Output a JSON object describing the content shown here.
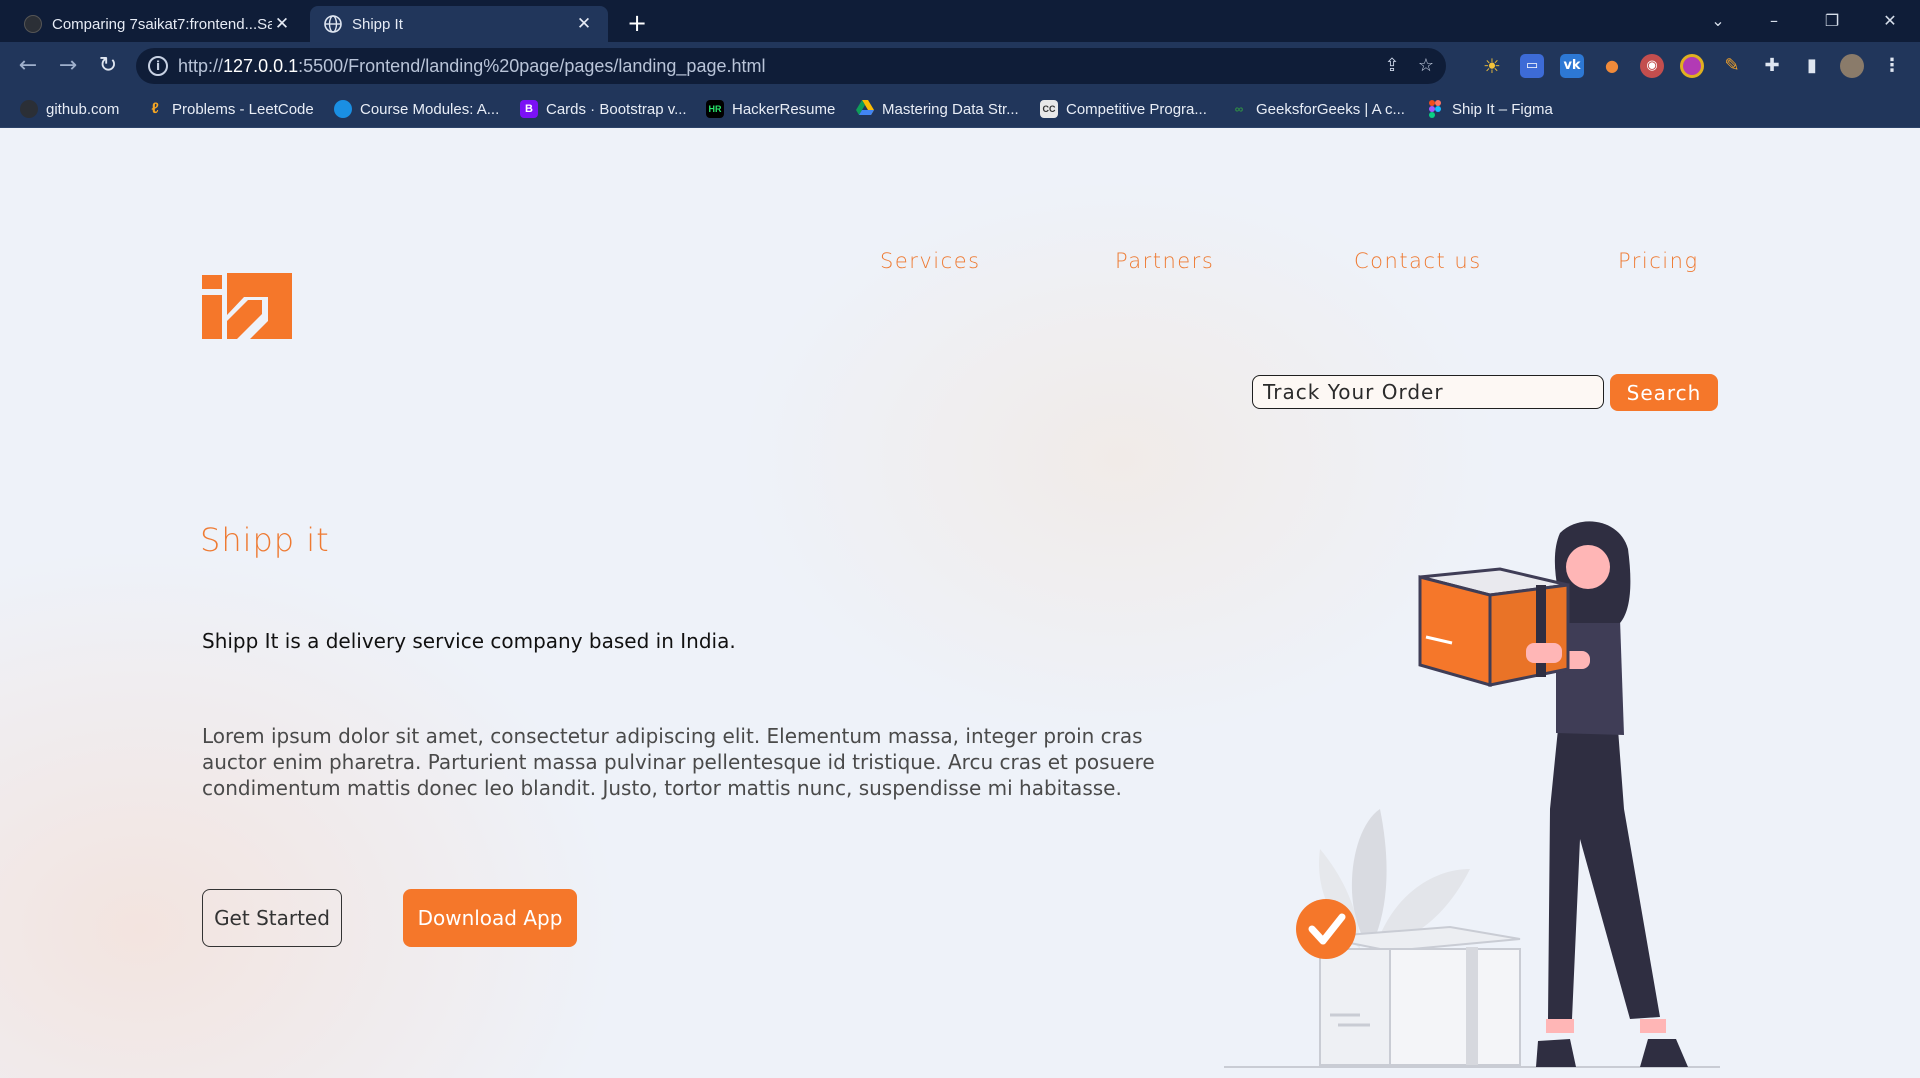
{
  "browser": {
    "tabs": [
      {
        "title": "Comparing 7saikat7:frontend...Sa",
        "active": false,
        "icon": "github-icon"
      },
      {
        "title": "Shipp It",
        "active": true,
        "icon": "globe-icon"
      }
    ],
    "address": {
      "scheme": "http://",
      "host": "127.0.0.1",
      "path": ":5500/Frontend/landing%20page/pages/landing_page.html"
    },
    "bookmarks": [
      {
        "label": "github.com",
        "icon": "github-icon"
      },
      {
        "label": "Problems - LeetCode",
        "icon": "leetcode-icon"
      },
      {
        "label": "Course Modules: A...",
        "icon": "cloud-icon"
      },
      {
        "label": "Cards · Bootstrap v...",
        "icon": "bootstrap-icon"
      },
      {
        "label": "HackerResume",
        "icon": "hackerresume-icon"
      },
      {
        "label": "Mastering Data Str...",
        "icon": "drive-icon"
      },
      {
        "label": "Competitive Progra...",
        "icon": "cc-icon"
      },
      {
        "label": "GeeksforGeeks | A c...",
        "icon": "gfg-icon"
      },
      {
        "label": "Ship It – Figma",
        "icon": "figma-icon"
      }
    ]
  },
  "nav": {
    "services": "Services",
    "partners": "Partners",
    "contact": "Contact us",
    "pricing": "Pricing"
  },
  "search": {
    "placeholder": "Track Your Order",
    "button": "Search"
  },
  "hero": {
    "title": "Shipp it",
    "tagline": "Shipp It is a delivery service company based in India.",
    "body": "Lorem ipsum dolor sit amet, consectetur adipiscing elit. Elementum massa, integer proin cras auctor enim pharetra. Parturient massa pulvinar pellentesque id tristique. Arcu cras et posuere condimentum mattis donec leo blandit. Justo, tortor mattis nunc, suspendisse mi habitasse.",
    "get_started": "Get Started",
    "download": "Download App"
  },
  "colors": {
    "accent": "#f5772a",
    "chrome_dark": "#0f1d38",
    "chrome": "#21365b"
  }
}
